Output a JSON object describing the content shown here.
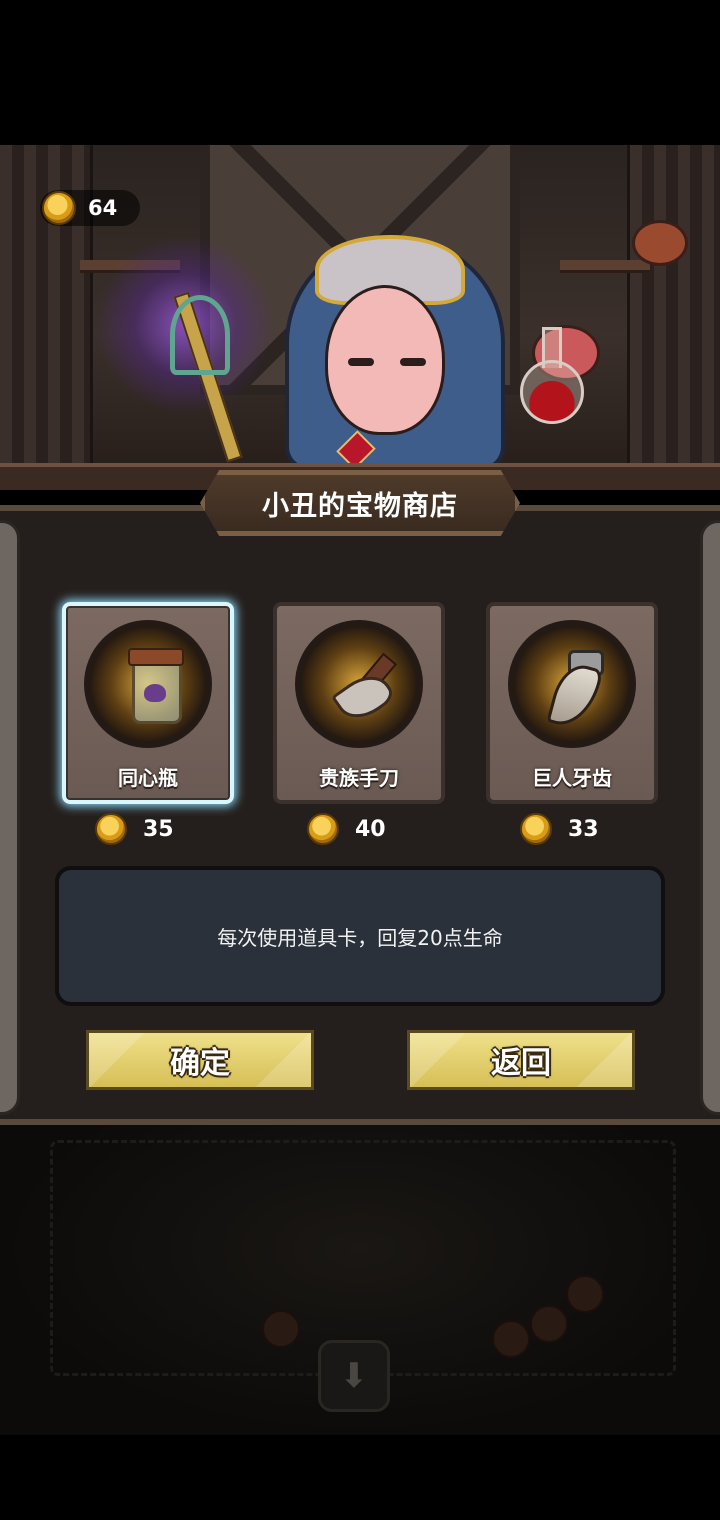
{
  "hud": {
    "coins": "64"
  },
  "shop": {
    "title": "小丑的宝物商店"
  },
  "items": [
    {
      "name": "同心瓶",
      "price": "35",
      "icon": "jar-icon",
      "selected": true
    },
    {
      "name": "贵族手刀",
      "price": "40",
      "icon": "knife-icon",
      "selected": false
    },
    {
      "name": "巨人牙齿",
      "price": "33",
      "icon": "fang-icon",
      "selected": false
    }
  ],
  "description": "每次使用道具卡，回复20点生命",
  "buttons": {
    "confirm": "确定",
    "back": "返回"
  },
  "colors": {
    "button_gold": "#e6d173",
    "selection_glow": "#8fdcff",
    "panel_bg": "#241f1c"
  }
}
